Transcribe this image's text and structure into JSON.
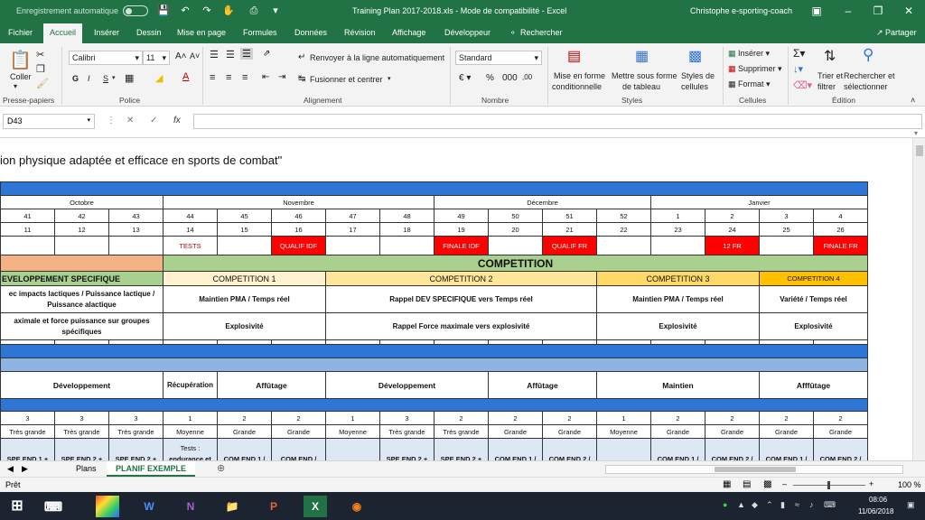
{
  "titlebar": {
    "autosave": "Enregistrement automatique",
    "title": "Training Plan 2017-2018.xls  -  Mode de compatibilité  -  Excel",
    "user": "Christophe e-sporting-coach"
  },
  "tabs": {
    "fichier": "Fichier",
    "accueil": "Accueil",
    "inserer": "Insérer",
    "dessin": "Dessin",
    "mise_en_page": "Mise en page",
    "formules": "Formules",
    "donnees": "Données",
    "revision": "Révision",
    "affichage": "Affichage",
    "developpeur": "Développeur",
    "rechercher": "Rechercher",
    "partager": "Partager"
  },
  "ribbon": {
    "coller": "Coller",
    "presse_papiers": "Presse-papiers",
    "font_name": "Calibri",
    "font_size": "11",
    "bold": "G",
    "italic": "I",
    "underline": "S",
    "police": "Police",
    "renvoyer": "Renvoyer à la ligne automatiquement",
    "fusionner": "Fusionner et centrer",
    "alignement": "Alignement",
    "number_format": "Standard",
    "nombre": "Nombre",
    "mise_en_forme_cond_1": "Mise en forme",
    "mise_en_forme_cond_2": "conditionnelle",
    "mettre_sous_forme_1": "Mettre sous forme",
    "mettre_sous_forme_2": "de tableau",
    "styles_cellules_1": "Styles de",
    "styles_cellules_2": "cellules",
    "styles": "Styles",
    "inserer": "Insérer",
    "supprimer": "Supprimer",
    "format": "Format",
    "cellules": "Cellules",
    "trier_1": "Trier et",
    "trier_2": "filtrer",
    "rechercher_sel_1": "Rechercher et",
    "rechercher_sel_2": "sélectionner",
    "edition": "Édition"
  },
  "formula_bar": {
    "name_box": "D43",
    "fx": "fx",
    "cancel": "✕",
    "enter": "✓"
  },
  "sheet": {
    "title": "ion physique adaptée et efficace en sports de combat\"",
    "months": {
      "octobre": "Octobre",
      "novembre": "Novembre",
      "decembre": "Décembre",
      "janvier": "Janvier"
    },
    "weeks": [
      "41",
      "42",
      "43",
      "44",
      "45",
      "46",
      "47",
      "48",
      "49",
      "50",
      "51",
      "52",
      "1",
      "2",
      "3",
      "4"
    ],
    "day_numbers": [
      "11",
      "12",
      "13",
      "14",
      "15",
      "16",
      "17",
      "18",
      "19",
      "20",
      "21",
      "22",
      "23",
      "24",
      "25",
      "26"
    ],
    "events": [
      "",
      "",
      "",
      "TESTS",
      "",
      "QUALIF IDF",
      "",
      "",
      "FINALE IDF",
      "",
      "QUALIF FR",
      "",
      "",
      "12 FR",
      "",
      "FINALE FR"
    ],
    "phase_dev": "EVELOPPEMENT SPECIFIQUE",
    "phase_comp": "COMPETITION",
    "competitions": [
      "COMPETITION 1",
      "COMPETITION 2",
      "COMPETITION 3",
      "COMPETITION 4"
    ],
    "row_a": [
      "ec impacts lactiques / Puissance lactique / Puissance alactique",
      "Maintien PMA / Temps réel",
      "Rappel DEV SPECIFIQUE vers Temps réel",
      "Maintien PMA / Temps réel",
      "Variété / Temps réel"
    ],
    "row_b": [
      "aximale et force puissance sur groupes spécifiques",
      "Explosivité",
      "Rappel Force maximale vers explosivité",
      "Explosivité",
      "Explosivité"
    ],
    "cycles": [
      "Développement",
      "Récupération",
      "Affûtage",
      "Développement",
      "Affûtage",
      "Maintien",
      "Afffûtage"
    ],
    "levels": [
      "3",
      "3",
      "3",
      "1",
      "2",
      "2",
      "1",
      "3",
      "2",
      "2",
      "2",
      "1",
      "2",
      "2",
      "2",
      "2"
    ],
    "intensity": [
      "Très grande",
      "Très grande",
      "Très grande",
      "Moyenne",
      "Grande",
      "Grande",
      "Moyenne",
      "Très grande",
      "Très grande",
      "Grande",
      "Grande",
      "Moyenne",
      "Grande",
      "Grande",
      "Grande",
      "Grande"
    ],
    "content_row1": [
      "",
      "",
      "",
      "Tests :",
      "",
      "",
      "",
      "",
      "",
      "",
      "",
      "",
      "",
      "",
      "",
      ""
    ],
    "content_row2": [
      "SPE END 1 +",
      "SPE END 2 +",
      "SPE END 2 +",
      "endurance et",
      "COM END 1 /",
      "COM END /",
      "",
      "SPE END 2 +",
      "SPE END 2 +",
      "COM END 1 /",
      "COM END 2 /",
      "",
      "COM END 1 /",
      "COM END 2 /",
      "COM END 1 /",
      "COM END 2 /"
    ]
  },
  "sheet_tabs": [
    "Plans",
    "PLANIF EXEMPLE"
  ],
  "status": {
    "ready": "Prêt",
    "zoom": "100 %"
  },
  "taskbar": {
    "time": "08:06",
    "date": "11/06/2018"
  }
}
